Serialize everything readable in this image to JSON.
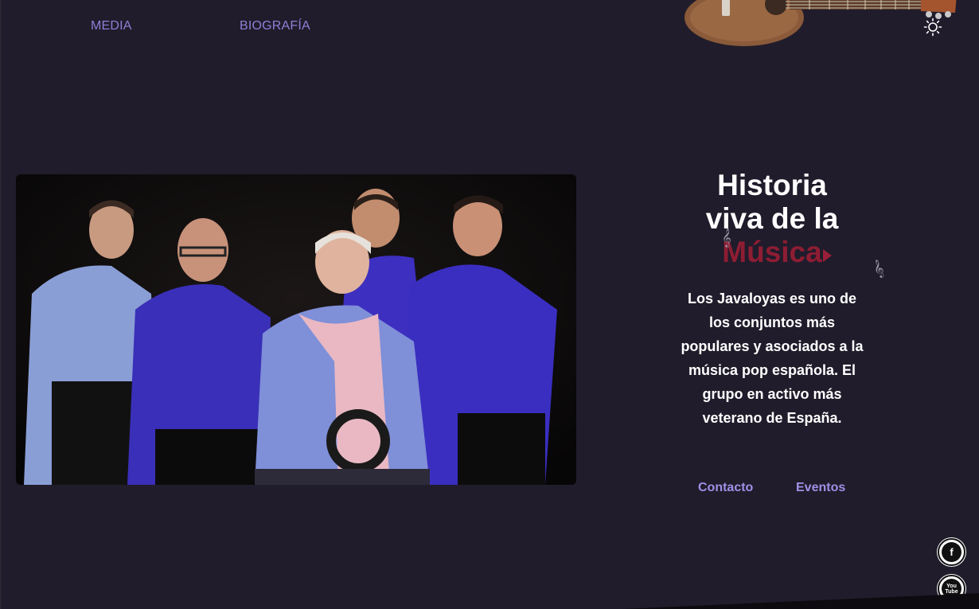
{
  "nav": {
    "media_label": "MEDIA",
    "bio_label": "BIOGRAFÍA"
  },
  "theme_toggle": {
    "icon": "sun-icon"
  },
  "hero": {
    "title_line1": "Historia",
    "title_line2": "viva de la",
    "title_accent": "Música",
    "description": "Los Javaloyas es uno de los conjuntos más populares y asociados a la música pop española. El grupo en activo más veterano de España.",
    "contact_label": "Contacto",
    "events_label": "Eventos"
  },
  "social": {
    "facebook_icon": "facebook-icon",
    "facebook_glyph": "f",
    "youtube_icon": "youtube-icon",
    "youtube_top": "You",
    "youtube_bottom": "Tube"
  },
  "colors": {
    "background": "#201c2b",
    "nav_link": "#8f7fd6",
    "accent": "#8e1d33",
    "cta": "#a18fe6",
    "text": "#ffffff"
  }
}
